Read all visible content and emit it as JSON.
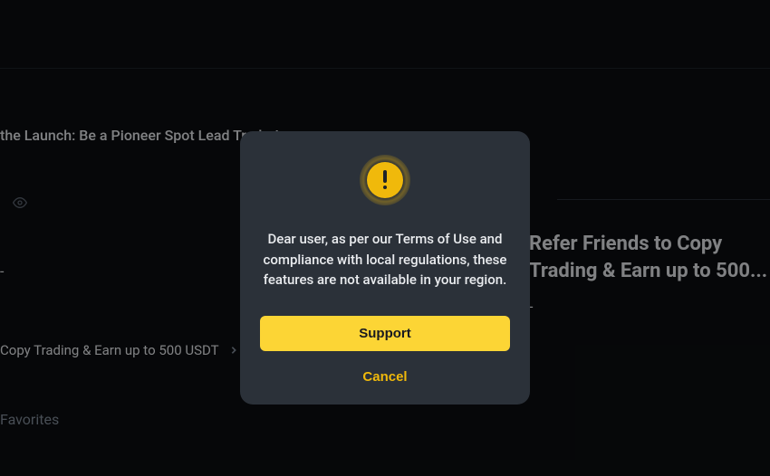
{
  "background": {
    "banner_text": "the Launch: Be a Pioneer Spot Lead Trader!",
    "dash": "-",
    "link_text": "Copy Trading & Earn up to 500 USDT",
    "favorites_label": "Favorites",
    "right_card_line1": "Refer Friends to Copy",
    "right_card_line2": "Trading & Earn up to 500...",
    "right_card_dash": "-"
  },
  "modal": {
    "message": "Dear user, as per our Terms of Use and compliance with local regulations, these features are not available in your region.",
    "support_label": "Support",
    "cancel_label": "Cancel"
  }
}
